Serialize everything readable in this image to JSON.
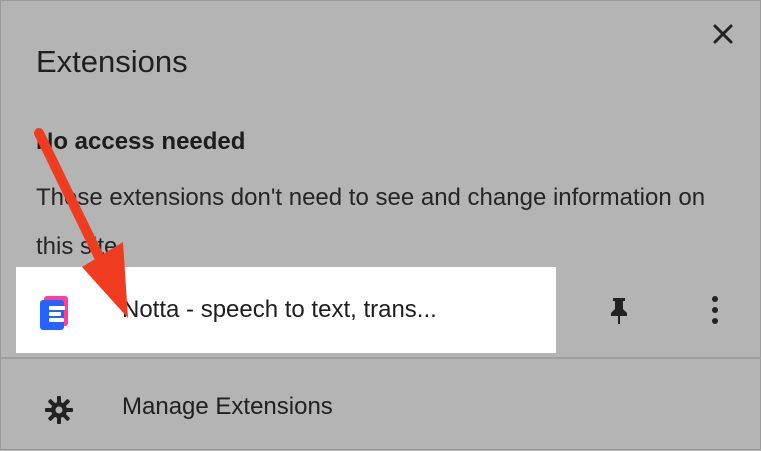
{
  "extensions_panel": {
    "title": "Extensions",
    "section_title": "No access needed",
    "section_description": "These extensions don't need to see and change information on this site.",
    "extension": {
      "name": "Notta - speech to text, trans...",
      "icon": "notta-logo-icon"
    },
    "manage_label": "Manage Extensions"
  },
  "icons": {
    "close": "close-icon",
    "pin": "pin-icon",
    "more": "more-vertical-icon",
    "settings": "gear-icon",
    "annotation": "red-arrow-icon"
  },
  "colors": {
    "highlight": "#ffffff",
    "arrow": "#ef3b1f",
    "panel_background": "#b4b4b4"
  }
}
